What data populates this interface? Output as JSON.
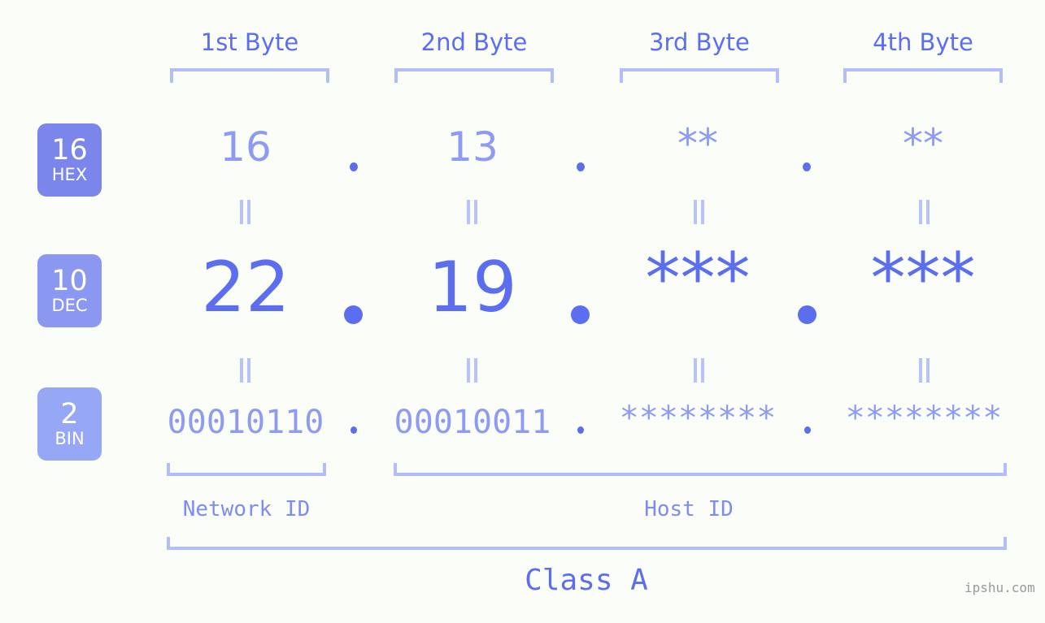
{
  "meta": {
    "background": "#fbfdf8",
    "accent": "#5b6ef0",
    "accent_light": "#8e9bf3",
    "bracket_color": "#b3bdfb"
  },
  "headers": [
    {
      "label": "1st Byte"
    },
    {
      "label": "2nd Byte"
    },
    {
      "label": "3rd Byte"
    },
    {
      "label": "4th Byte"
    }
  ],
  "bases": [
    {
      "num": "16",
      "name": "HEX",
      "color": "#7b86ea"
    },
    {
      "num": "10",
      "name": "DEC",
      "color": "#8b98f2"
    },
    {
      "num": "2",
      "name": "BIN",
      "color": "#96a7f5"
    }
  ],
  "rows": {
    "hex": {
      "values": [
        "16",
        "13",
        "**",
        "**"
      ]
    },
    "dec": {
      "values": [
        "22",
        "19",
        "***",
        "***"
      ]
    },
    "bin": {
      "values": [
        "00010110",
        "00010011",
        "********",
        "********"
      ]
    }
  },
  "separator": ".",
  "zones": [
    {
      "label": "Network ID"
    },
    {
      "label": "Host ID"
    }
  ],
  "class": {
    "label": "Class A"
  },
  "watermark": {
    "text": "ipshu.com"
  }
}
